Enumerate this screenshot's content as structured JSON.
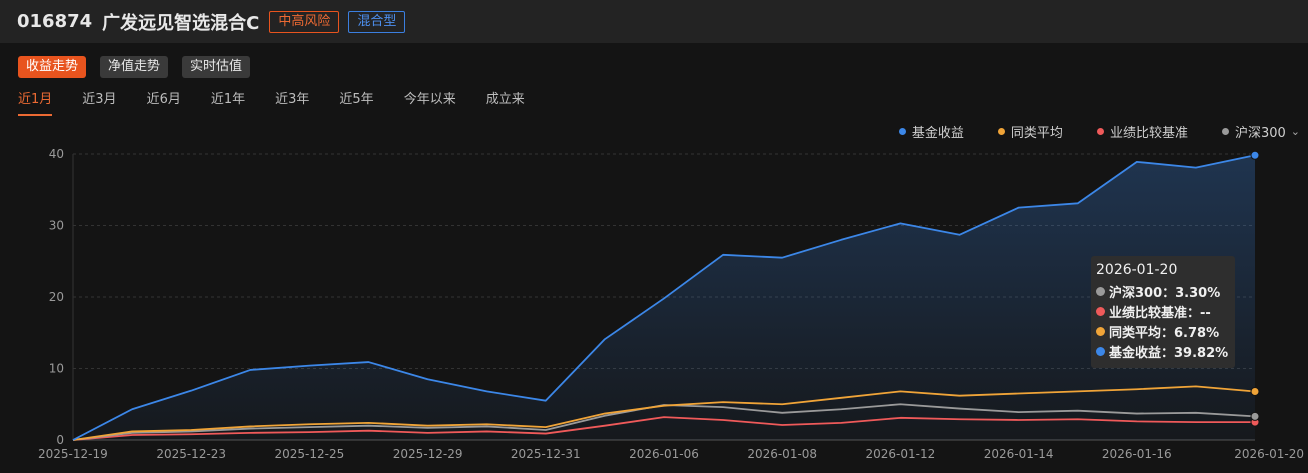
{
  "header": {
    "code": "016874",
    "name": "广发远见智选混合C",
    "risk_tag": "中高风险",
    "type_tag": "混合型"
  },
  "view_tabs": [
    {
      "label": "收益走势",
      "active": true
    },
    {
      "label": "净值走势",
      "active": false
    },
    {
      "label": "实时估值",
      "active": false
    }
  ],
  "range_tabs": [
    {
      "label": "近1月",
      "active": true
    },
    {
      "label": "近3月",
      "active": false
    },
    {
      "label": "近6月",
      "active": false
    },
    {
      "label": "近1年",
      "active": false
    },
    {
      "label": "近3年",
      "active": false
    },
    {
      "label": "近5年",
      "active": false
    },
    {
      "label": "今年以来",
      "active": false
    },
    {
      "label": "成立来",
      "active": false
    }
  ],
  "legend": [
    {
      "label": "基金收益",
      "color": "#3c87e8"
    },
    {
      "label": "同类平均",
      "color": "#f0a438"
    },
    {
      "label": "业绩比较基准",
      "color": "#ef5a5a"
    },
    {
      "label": "沪深300",
      "color": "#9a9a9a",
      "dropdown_icon": "chevron-down-icon"
    }
  ],
  "tooltip": {
    "date": "2026-01-20",
    "rows": [
      {
        "label": "沪深300：3.30%",
        "color": "#9a9a9a"
      },
      {
        "label": "业绩比较基准：--",
        "color": "#ef5a5a"
      },
      {
        "label": "同类平均：6.78%",
        "color": "#f0a438"
      },
      {
        "label": "基金收益：39.82%",
        "color": "#3c87e8"
      }
    ]
  },
  "chart_data": {
    "type": "area",
    "x": [
      "2025-12-19",
      "2025-12-22",
      "2025-12-23",
      "2025-12-24",
      "2025-12-25",
      "2025-12-26",
      "2025-12-29",
      "2025-12-30",
      "2025-12-31",
      "2026-01-05",
      "2026-01-06",
      "2026-01-07",
      "2026-01-08",
      "2026-01-09",
      "2026-01-12",
      "2026-01-13",
      "2026-01-14",
      "2026-01-15",
      "2026-01-16",
      "2026-01-19",
      "2026-01-20"
    ],
    "x_ticks": [
      "2025-12-19",
      "2025-12-23",
      "2025-12-25",
      "2025-12-29",
      "2025-12-31",
      "2026-01-06",
      "2026-01-08",
      "2026-01-12",
      "2026-01-14",
      "2026-01-16",
      "2026-01-20"
    ],
    "y_ticks": [
      0,
      10,
      20,
      30,
      40
    ],
    "ylim": [
      0,
      40
    ],
    "grid": true,
    "series": [
      {
        "name": "基金收益",
        "color": "#3c87e8",
        "fill": true,
        "values": [
          0,
          4.3,
          6.9,
          9.8,
          10.4,
          10.9,
          8.5,
          6.8,
          5.5,
          14.1,
          19.8,
          25.9,
          25.5,
          28.0,
          30.3,
          28.7,
          32.5,
          33.1,
          38.9,
          38.1,
          39.82
        ]
      },
      {
        "name": "同类平均",
        "color": "#f0a438",
        "values": [
          0,
          1.2,
          1.4,
          1.9,
          2.2,
          2.4,
          2.0,
          2.2,
          1.8,
          3.7,
          4.8,
          5.3,
          5.0,
          5.9,
          6.8,
          6.2,
          6.5,
          6.8,
          7.1,
          7.5,
          6.78
        ]
      },
      {
        "name": "沪深300",
        "color": "#9a9a9a",
        "values": [
          0,
          1.0,
          1.2,
          1.6,
          1.8,
          2.0,
          1.7,
          1.9,
          1.4,
          3.4,
          4.9,
          4.6,
          3.8,
          4.3,
          5.0,
          4.4,
          3.9,
          4.1,
          3.7,
          3.8,
          3.3
        ]
      },
      {
        "name": "业绩比较基准",
        "color": "#ef5a5a",
        "values": [
          0,
          0.7,
          0.8,
          1.0,
          1.1,
          1.3,
          1.0,
          1.2,
          0.9,
          2.0,
          3.2,
          2.8,
          2.1,
          2.4,
          3.1,
          2.9,
          2.8,
          2.9,
          2.6,
          2.5,
          2.5
        ]
      }
    ]
  }
}
